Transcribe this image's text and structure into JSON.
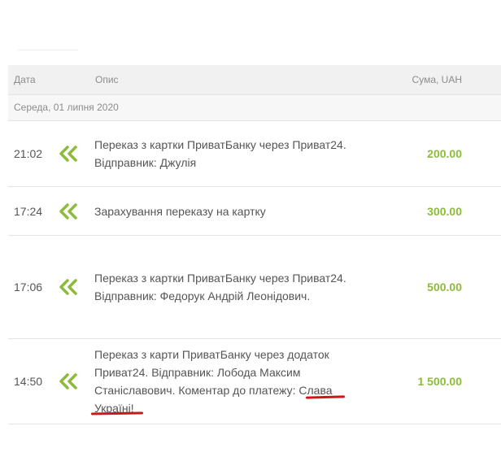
{
  "table": {
    "columns": {
      "date": "Дата",
      "description": "Опис",
      "amount": "Сума, UAH"
    },
    "day_label": "Середа, 01 липня 2020",
    "rows": [
      {
        "time": "21:02",
        "description": "Переказ з картки ПриватБанку через Приват24. Відправник:  Джулія",
        "amount": "200.00",
        "icon": "double-chevron-left-icon"
      },
      {
        "time": "17:24",
        "description": "Зарахування переказу на картку",
        "amount": "300.00",
        "icon": "double-chevron-left-icon"
      },
      {
        "time": "17:06",
        "description": "Переказ з картки ПриватБанку через Приват24. Відправник: Федорук Андрій Леонідович.",
        "amount": "500.00",
        "icon": "double-chevron-left-icon"
      },
      {
        "time": "14:50",
        "description": "Переказ з карти ПриватБанку через додаток Приват24. Відправник: Лобода Максим Станіславович. Коментар до платежу: Слава Україні!",
        "amount": "1 500.00",
        "icon": "double-chevron-left-icon"
      }
    ]
  },
  "colors": {
    "accent_green": "#8cbb3c",
    "highlight_red": "#d4141c"
  }
}
